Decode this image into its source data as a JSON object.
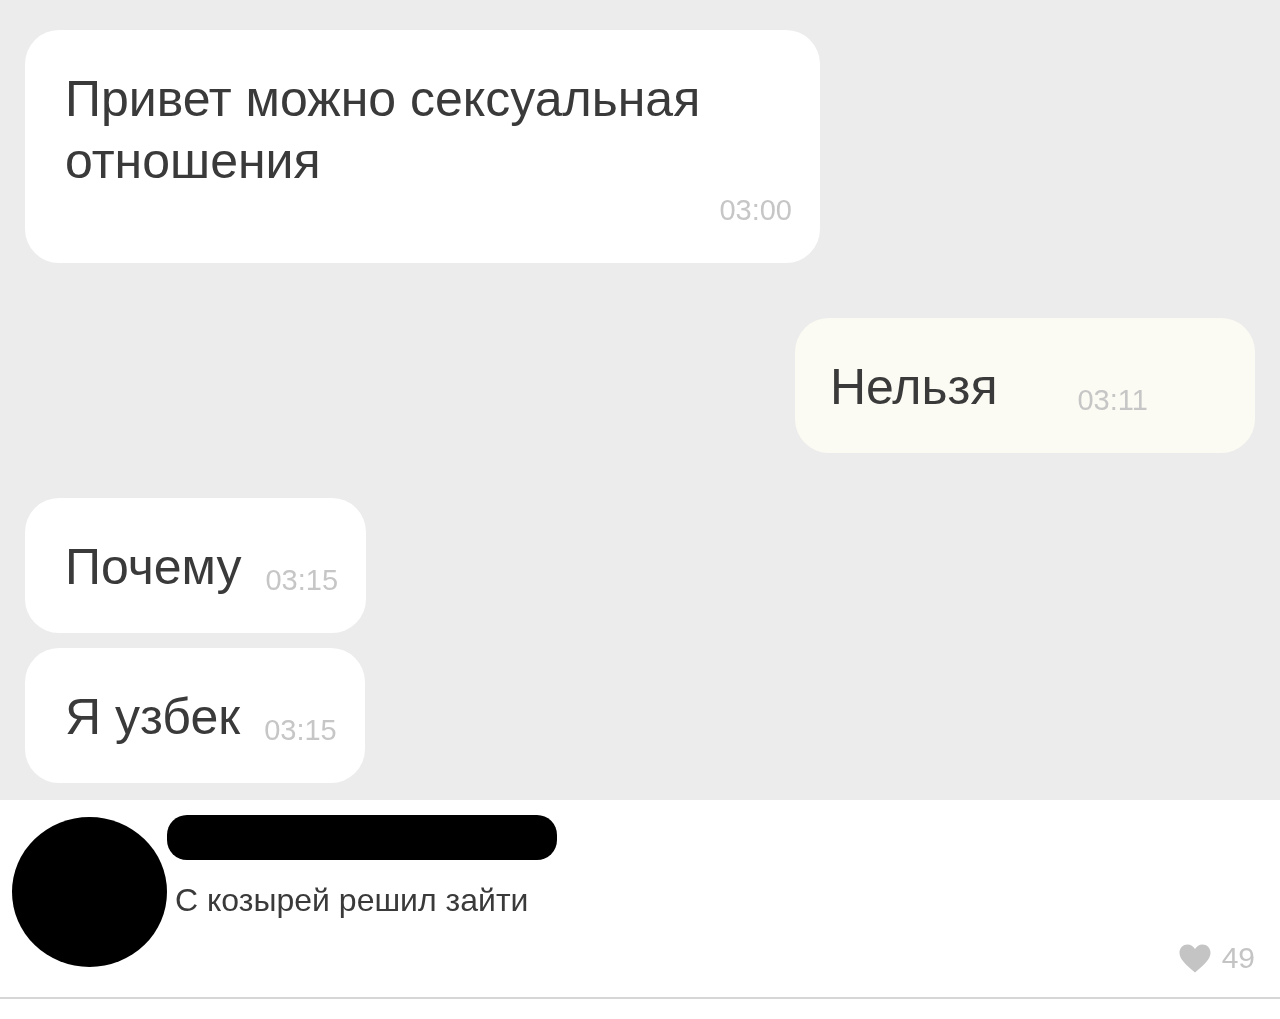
{
  "messages": [
    {
      "kind": "incoming",
      "text": "Привет можно сексуальная отношения",
      "time": "03:00"
    },
    {
      "kind": "outgoing",
      "text": "Нельзя",
      "time": "03:11"
    },
    {
      "kind": "incoming",
      "text": "Почему",
      "time": "03:15"
    },
    {
      "kind": "incoming",
      "text": "Я узбек",
      "time": "03:15"
    }
  ],
  "comment": {
    "text": "С козырей решил зайти",
    "likes": "49"
  }
}
